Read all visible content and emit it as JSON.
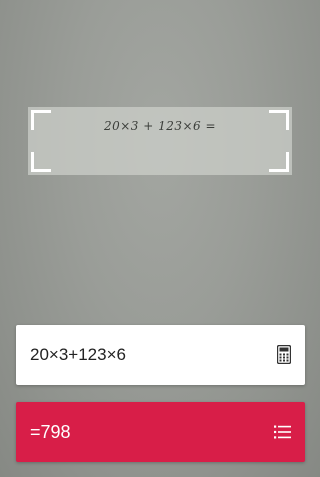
{
  "scanner": {
    "handwritten_expression": "20×3 + 123×6 ="
  },
  "expression_card": {
    "expression": "20×3+123×6",
    "icon": "calculator-icon"
  },
  "result_card": {
    "result": "=798",
    "icon": "list-icon"
  },
  "colors": {
    "result_background": "#d81e48",
    "card_background": "#ffffff"
  }
}
